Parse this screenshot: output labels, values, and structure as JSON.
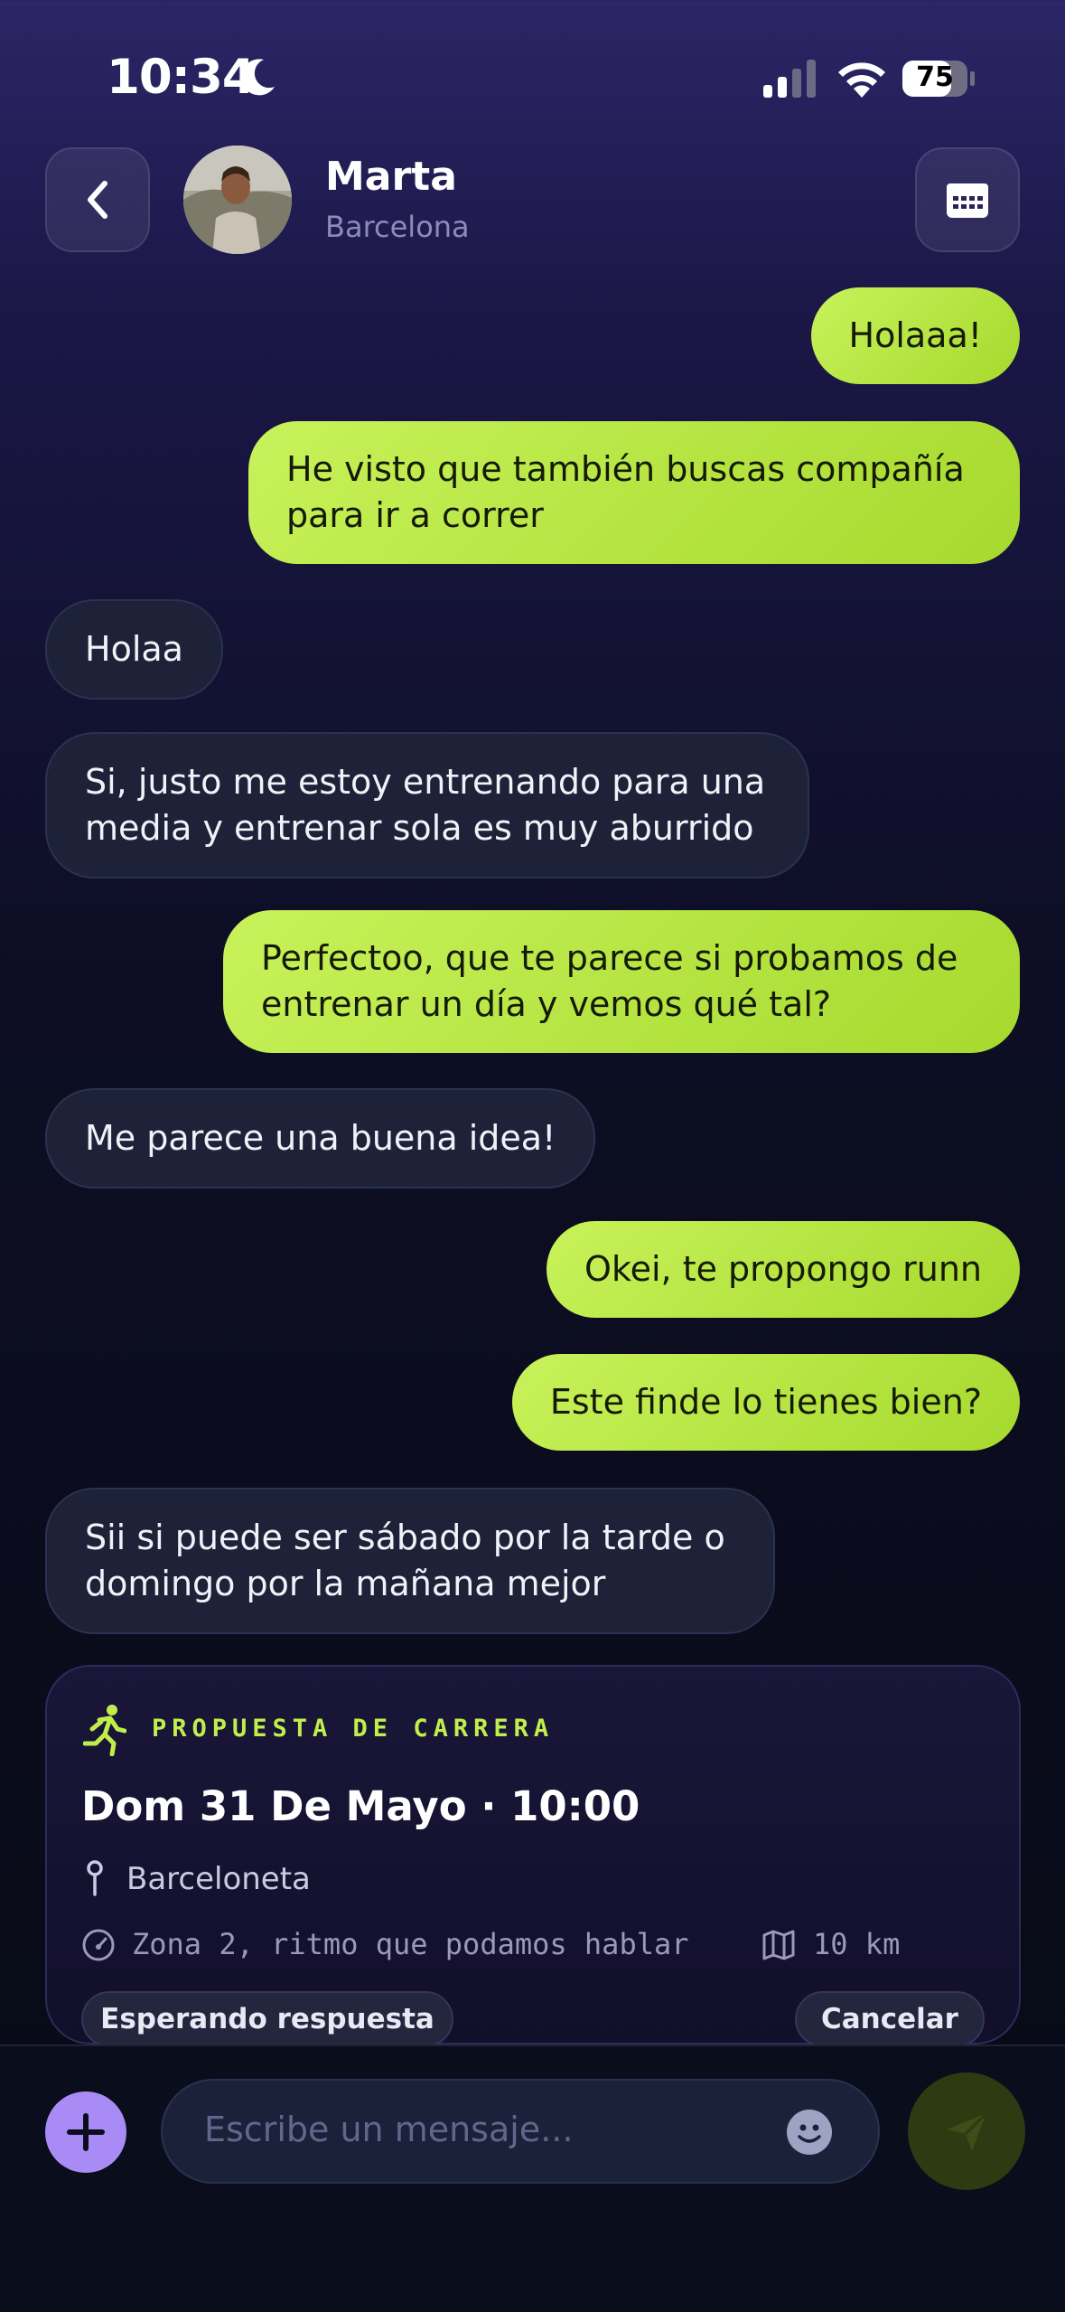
{
  "status_bar": {
    "time": "10:34",
    "battery": "75"
  },
  "header": {
    "contact_name": "Marta",
    "contact_location": "Barcelona"
  },
  "messages": [
    {
      "from": "me",
      "text": "Holaaa!"
    },
    {
      "from": "me",
      "text": "He visto que también buscas compañía para ir a correr"
    },
    {
      "from": "them",
      "text": "Holaa"
    },
    {
      "from": "them",
      "text": "Si, justo me estoy entrenando para una media y entrenar sola es muy aburrido"
    },
    {
      "from": "me",
      "text": "Perfectoo, que te parece si probamos de entrenar un día y vemos qué tal?"
    },
    {
      "from": "them",
      "text": "Me parece una buena idea!"
    },
    {
      "from": "me",
      "text": "Okei, te propongo runn"
    },
    {
      "from": "me",
      "text": "Este finde lo tienes bien?"
    },
    {
      "from": "them",
      "text": "Sii si puede ser sábado por la tarde o domingo por la mañana mejor"
    }
  ],
  "proposal": {
    "kicker": "PROPUESTA DE CARRERA",
    "date_time": "Dom 31 De Mayo · 10:00",
    "location": "Barceloneta",
    "zone": "Zona 2, ritmo que podamos hablar",
    "distance": "10 km",
    "status": "Esperando respuesta",
    "cancel_label": "Cancelar"
  },
  "composer": {
    "placeholder": "Escribe un mensaje..."
  },
  "colors": {
    "accent_green": "#b8e83c",
    "accent_purple": "#a98bf6",
    "bubble_dark": "#1d2239"
  }
}
